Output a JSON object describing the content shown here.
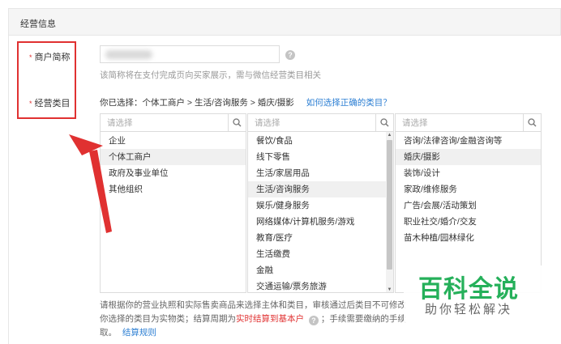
{
  "section": {
    "title": "经营信息"
  },
  "fields": {
    "merchant_short_name": {
      "required_mark": "*",
      "label": "商户简称",
      "hint": "该简称将在支付完成页向买家展示，需与微信经营类目相关"
    },
    "business_category": {
      "required_mark": "*",
      "label": "经营类目",
      "selected_prefix": "你已选择：",
      "selected_path": "个体工商户 > 生活/咨询服务 > 婚庆/摄影",
      "help_link": "如何选择正确的类目？"
    }
  },
  "panels": [
    {
      "search_placeholder": "请选择",
      "items": [
        "企业",
        "个体工商户",
        "政府及事业单位",
        "其他组织"
      ],
      "selected": "个体工商户"
    },
    {
      "search_placeholder": "请选择",
      "items": [
        "餐饮/食品",
        "线下零售",
        "生活/家居用品",
        "生活/咨询服务",
        "娱乐/健身服务",
        "网络媒体/计算机服务/游戏",
        "教育/医疗",
        "生活缴费",
        "金融",
        "交通运输/票务旅游"
      ],
      "selected": "生活/咨询服务"
    },
    {
      "search_placeholder": "请选择",
      "items": [
        "咨询/法律咨询/金融咨询等",
        "婚庆/摄影",
        "装饰/设计",
        "家政/维修服务",
        "广告/会展/活动策划",
        "职业社交/婚介/交友",
        "苗木种植/园林绿化"
      ],
      "selected": "婚庆/摄影"
    }
  ],
  "footer": {
    "line1": "请根据你的营业执照和实际售卖商品来选择主体和类目，审核通过后类目不可修改",
    "line2_a": "你选择的类目为实物类；结算周期为",
    "line2_red": "实时结算到基本户",
    "line2_b": "；手续需要缴纳的手续",
    "line3_a": "取。",
    "line3_link": "结算规则"
  },
  "icons": {
    "help": "question-circle-icon",
    "search": "search-icon",
    "scroll_up": "scroll-up-icon",
    "scroll_down": "scroll-down-icon"
  },
  "watermark": {
    "title": "百科全说",
    "subtitle": "助你轻松解决"
  },
  "colors": {
    "required": "#e03131",
    "link": "#2d7fd3",
    "annotation": "#e03131",
    "watermark": "#25b05a"
  }
}
